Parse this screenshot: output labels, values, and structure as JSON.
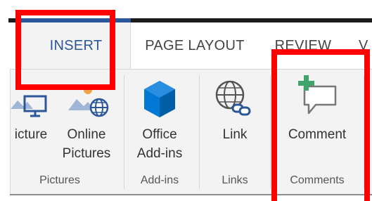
{
  "tabs": {
    "insert": "INSERT",
    "page_layout": "PAGE LAYOUT",
    "review": "REVIEW",
    "view_partial": "V"
  },
  "groups": {
    "pictures": {
      "label": "Pictures",
      "buttons": [
        {
          "label": "icture",
          "icon": "picture-icon"
        },
        {
          "label_line1": "Online",
          "label_line2": "Pictures",
          "icon": "online-pictures-icon"
        }
      ]
    },
    "addins": {
      "label": "Add-ins",
      "button": {
        "label_line1": "Office",
        "label_line2": "Add-ins",
        "icon": "office-addins-icon"
      }
    },
    "links": {
      "label": "Links",
      "button": {
        "label": "Link",
        "icon": "link-icon"
      }
    },
    "comments": {
      "label": "Comments",
      "button": {
        "label": "Comment",
        "icon": "new-comment-icon"
      }
    }
  },
  "colors": {
    "accent": "#2b579a",
    "office_blue": "#0078d4",
    "comment_green": "#3fa66b",
    "highlight": "#ff0000"
  }
}
